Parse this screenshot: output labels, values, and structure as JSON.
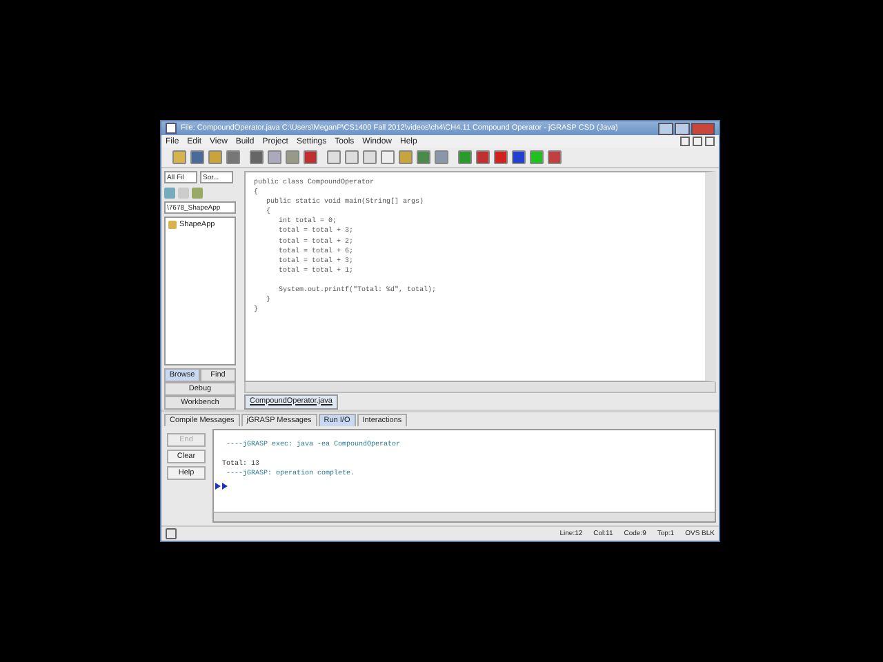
{
  "window": {
    "title": "File: CompoundOperator.java  C:\\Users\\MeganP\\CS1400 Fall 2012\\videos\\ch4\\CH4.11 Compound Operator - jGRASP CSD (Java)"
  },
  "menu": [
    "File",
    "Edit",
    "View",
    "Build",
    "Project",
    "Settings",
    "Tools",
    "Window",
    "Help"
  ],
  "browser": {
    "filter": "All Fil",
    "sort": "Sor...",
    "project": "\\7678_ShapeApp",
    "items": [
      {
        "label": "ShapeApp"
      }
    ],
    "tabs": [
      {
        "label": "Browse",
        "selected": true
      },
      {
        "label": "Find",
        "selected": false
      },
      {
        "label": "Debug",
        "selected": false
      },
      {
        "label": "Workbench",
        "selected": false
      }
    ]
  },
  "editor": {
    "blocks": [
      [
        "public class CompoundOperator",
        "{",
        "   public static void main(String[] args)",
        "   {",
        "      int total = 0;",
        "      total = total + 3;",
        "      total = total + 2;",
        "      total = total + 6;",
        "      total = total + 3;",
        "      total = total + 1;"
      ],
      [
        "      System.out.printf(\"Total: %d\", total);",
        "   }",
        "}"
      ]
    ],
    "file_tabs": [
      {
        "label": "CompoundOperator.java"
      }
    ]
  },
  "messages": {
    "tabs": [
      {
        "label": "Compile Messages",
        "selected": false
      },
      {
        "label": "jGRASP Messages",
        "selected": false
      },
      {
        "label": "Run I/O",
        "selected": true
      },
      {
        "label": "Interactions",
        "selected": false
      }
    ],
    "buttons": [
      {
        "label": "End",
        "disabled": true
      },
      {
        "label": "Clear",
        "disabled": false
      },
      {
        "label": "Help",
        "disabled": false
      }
    ],
    "blocks": [
      [
        " ----jGRASP exec: java -ea CompoundOperator"
      ],
      [
        "Total: 13",
        " ----jGRASP: operation complete."
      ]
    ]
  },
  "status_bar": {
    "line": "Line:12",
    "col": "Col:11",
    "code": "Code:9",
    "top": "Top:1",
    "mode": "OVS BLK"
  }
}
